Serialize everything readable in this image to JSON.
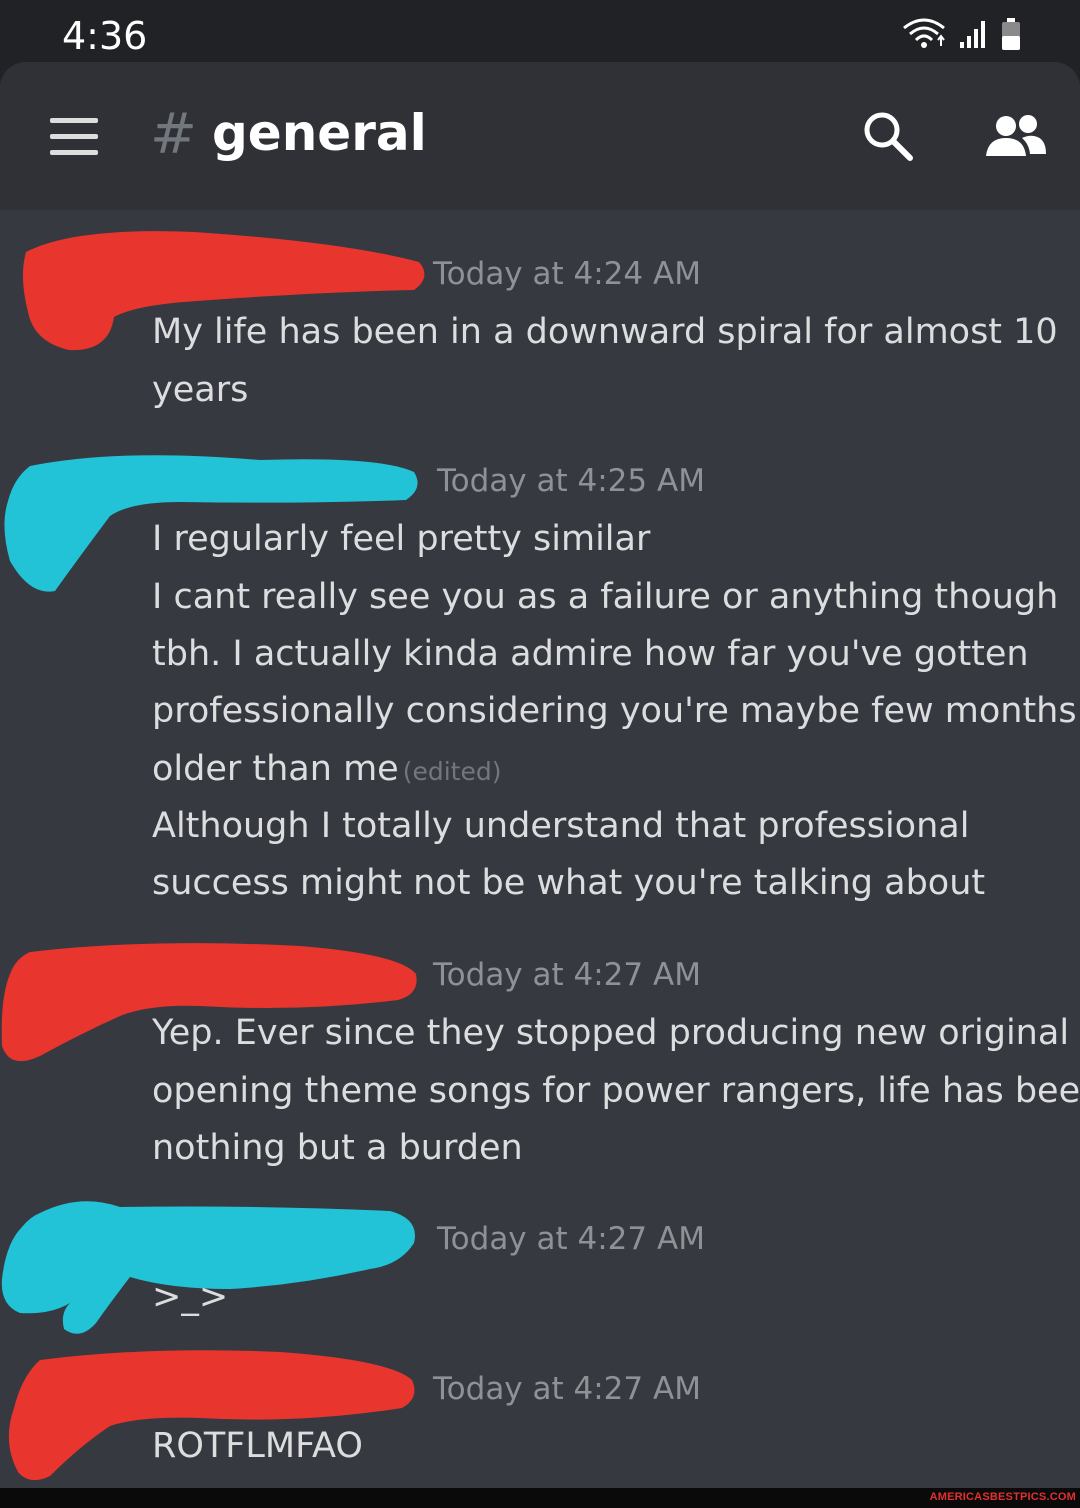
{
  "status_bar": {
    "time": "4:36",
    "icons": [
      "wifi-icon",
      "signal-icon",
      "battery-icon"
    ]
  },
  "header": {
    "hash_symbol": "#",
    "channel_name": "general",
    "icons": [
      "menu-icon",
      "search-icon",
      "members-icon"
    ]
  },
  "messages": [
    {
      "timestamp": "Today at 4:24 AM",
      "redaction_color": "#e8352e",
      "lines": [
        "My life has been in a downward spiral for almost 10",
        "years"
      ]
    },
    {
      "timestamp": "Today at 4:25 AM",
      "redaction_color": "#22c3d6",
      "lines": [
        "I regularly feel pretty similar",
        "I cant really see you as a failure or anything though",
        "tbh. I actually kinda admire how far you've gotten",
        "professionally considering you're maybe few months",
        "older than me",
        "Although I totally understand that professional",
        "success might not be what you're talking about"
      ],
      "edited_label": "(edited)"
    },
    {
      "timestamp": "Today at 4:27 AM",
      "redaction_color": "#e8352e",
      "lines": [
        "Yep. Ever since they stopped producing new original",
        "opening theme songs for power rangers, life has been",
        "nothing but a burden"
      ]
    },
    {
      "timestamp": "Today at 4:27 AM",
      "redaction_color": "#22c3d6",
      "lines": [
        ">_>"
      ]
    },
    {
      "timestamp": "Today at 4:27 AM",
      "redaction_color": "#e8352e",
      "lines": [
        "ROTFLMFAO"
      ]
    }
  ],
  "colors": {
    "background": "#36393f",
    "header": "#2f3136",
    "text": "#dcddde",
    "muted": "#8e9297",
    "red_scribble": "#e8352e",
    "cyan_scribble": "#22c3d6"
  },
  "watermark": "AMERICASBESTPICS.COM"
}
